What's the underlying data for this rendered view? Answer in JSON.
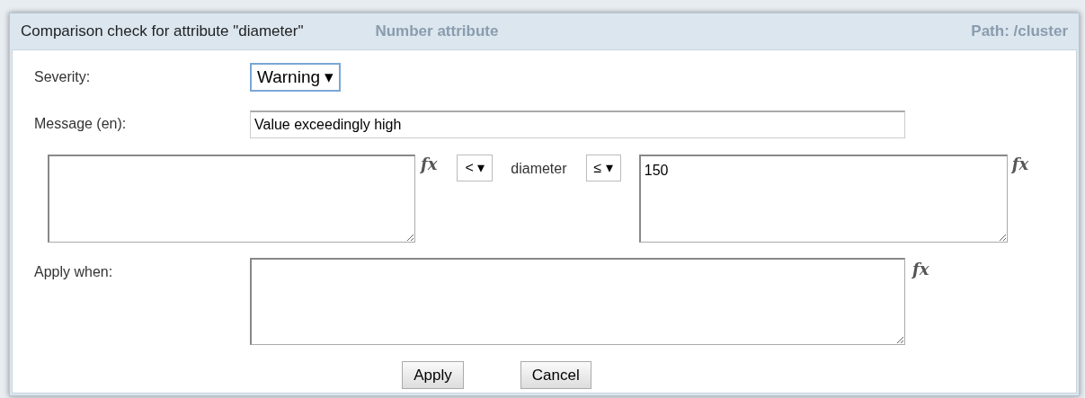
{
  "backdrop": {
    "heading": "Number attribute",
    "path": "Path: /cluster"
  },
  "dialog": {
    "title": "Comparison check for attribute \"diameter\"",
    "severity": {
      "label": "Severity:",
      "value": "Warning ▾"
    },
    "message": {
      "label": "Message (en):",
      "value": "Value exceedingly high"
    },
    "comparison": {
      "lower_expression": {
        "fx": "fx"
      },
      "lower_operator": "< ▾",
      "attribute": "diameter",
      "upper_operator": "≤ ▾",
      "upper_expression": {
        "value": "150",
        "fx": "fx"
      }
    },
    "apply_when": {
      "label": "Apply when:",
      "fx": "fx"
    },
    "buttons": [
      "Apply",
      "Cancel"
    ]
  }
}
